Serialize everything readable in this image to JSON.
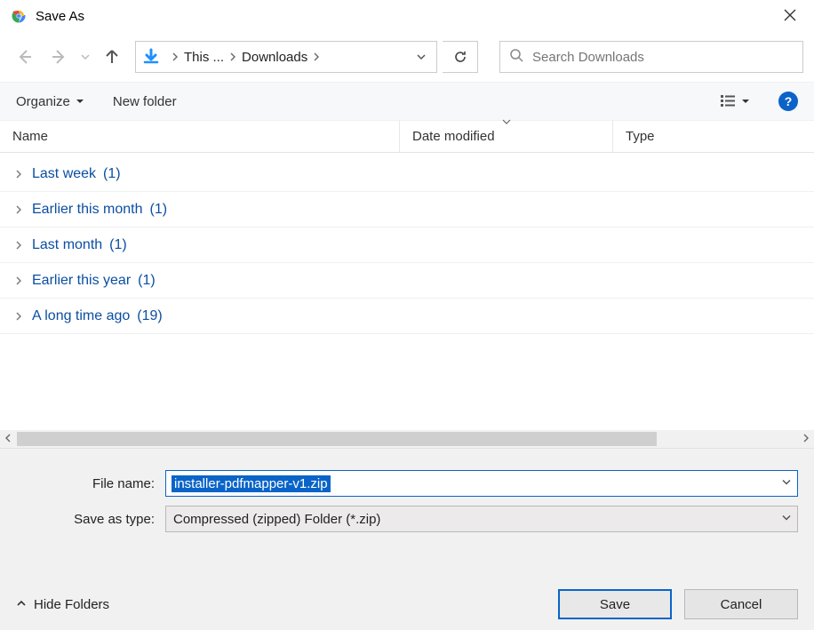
{
  "title": "Save As",
  "nav": {
    "breadcrumb_root": "This ...",
    "breadcrumb_folder": "Downloads",
    "search_placeholder": "Search Downloads"
  },
  "toolbar": {
    "organize_label": "Organize",
    "newfolder_label": "New folder",
    "help_label": "?"
  },
  "columns": {
    "name": "Name",
    "date": "Date modified",
    "type": "Type"
  },
  "groups": [
    {
      "label": "Last week",
      "count": 1
    },
    {
      "label": "Earlier this month",
      "count": 1
    },
    {
      "label": "Last month",
      "count": 1
    },
    {
      "label": "Earlier this year",
      "count": 1
    },
    {
      "label": "A long time ago",
      "count": 19
    }
  ],
  "form": {
    "filename_label": "File name:",
    "filename_value": "installer-pdfmapper-v1.zip",
    "savetype_label": "Save as type:",
    "savetype_value": "Compressed (zipped) Folder (*.zip)",
    "hide_folders_label": "Hide Folders",
    "save_label": "Save",
    "cancel_label": "Cancel"
  }
}
